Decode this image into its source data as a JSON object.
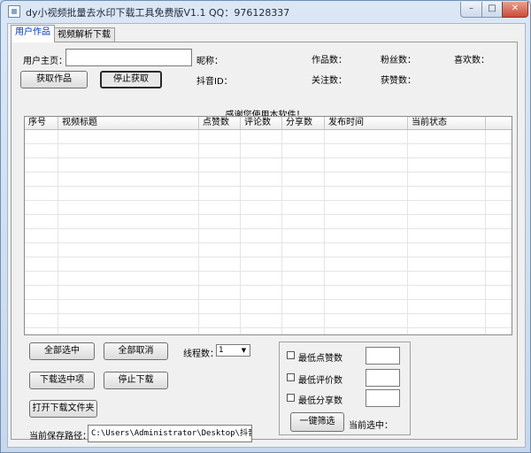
{
  "window": {
    "title": "dy小视频批量去水印下载工具免费版V1.1 QQ：976128337",
    "controls": {
      "minimize": "–",
      "maximize": "□",
      "close": "✕"
    }
  },
  "tabs": [
    {
      "label": "用户作品",
      "active": true
    },
    {
      "label": "视频解析下载",
      "active": false
    }
  ],
  "user": {
    "homepage_label": "用户主页：",
    "homepage_value": "",
    "nickname_label": "昵称：",
    "works_label": "作品数：",
    "fans_label": "粉丝数：",
    "likes_label": "喜欢数：",
    "douyin_id_label": "抖音ID：",
    "follow_label": "关注数：",
    "praised_label": "获赞数："
  },
  "buttons": {
    "fetch": "获取作品",
    "stop_fetch": "停止获取",
    "select_all": "全部选中",
    "deselect_all": "全部取消",
    "download_selected": "下载选中项",
    "stop_download": "停止下载",
    "open_folder": "打开下载文件夹",
    "filter": "一键筛选"
  },
  "list": {
    "group_title": "感谢您使用本软件！",
    "columns": [
      "序号",
      "视频标题",
      "点赞数",
      "评论数",
      "分享数",
      "发布时间",
      "当前状态"
    ]
  },
  "threads": {
    "label": "线程数：",
    "value": "1"
  },
  "save_path": {
    "label": "当前保存路径：",
    "value": "C:\\Users\\Administrator\\Desktop\\抖音视频批量"
  },
  "filters": {
    "min_likes": "最低点赞数",
    "min_comments": "最低评价数",
    "min_shares": "最低分享数",
    "current_selected_label": "当前选中："
  }
}
